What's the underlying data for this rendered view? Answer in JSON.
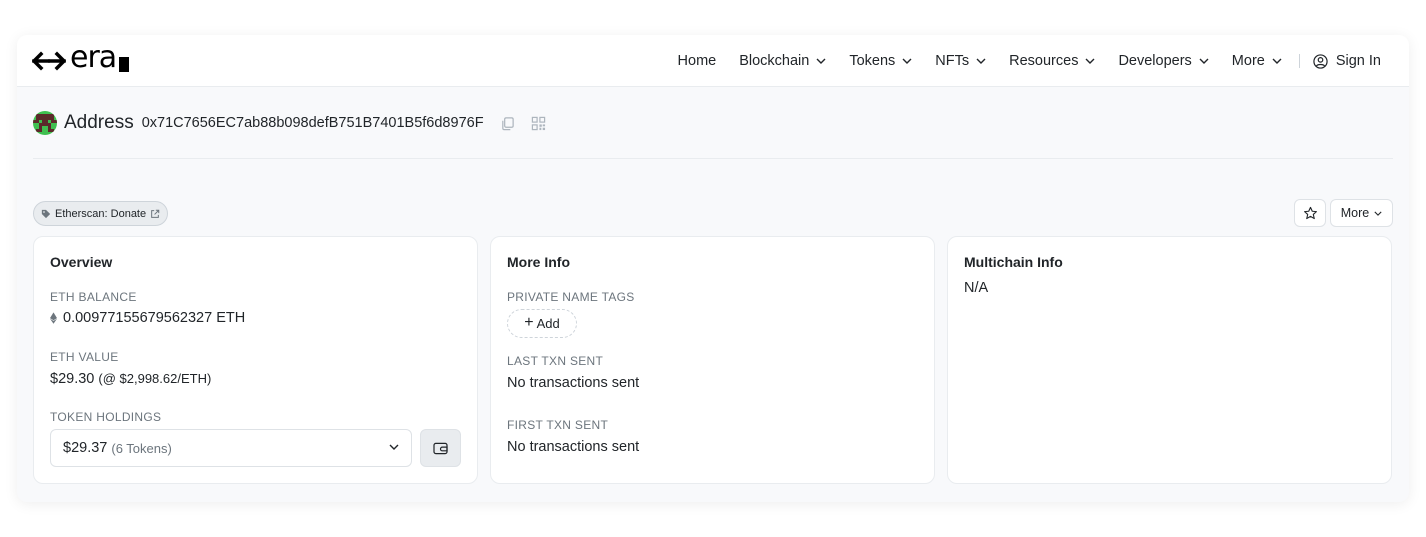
{
  "brand": {
    "logo_text": "era"
  },
  "nav": {
    "items": [
      {
        "label": "Home",
        "has_dropdown": false
      },
      {
        "label": "Blockchain",
        "has_dropdown": true
      },
      {
        "label": "Tokens",
        "has_dropdown": true
      },
      {
        "label": "NFTs",
        "has_dropdown": true
      },
      {
        "label": "Resources",
        "has_dropdown": true
      },
      {
        "label": "Developers",
        "has_dropdown": true
      },
      {
        "label": "More",
        "has_dropdown": true
      }
    ],
    "sign_in": "Sign In"
  },
  "address": {
    "title": "Address",
    "hash": "0x71C7656EC7ab88b098defB751B7401B5f6d8976F"
  },
  "tag": {
    "label": "Etherscan: Donate",
    "icon": "tag-icon"
  },
  "actions": {
    "more_label": "More"
  },
  "overview": {
    "title": "Overview",
    "eth_balance_label": "ETH BALANCE",
    "eth_balance_value": "0.00977155679562327 ETH",
    "eth_value_label": "ETH VALUE",
    "eth_value_amount": "$29.30",
    "eth_value_rate": "(@ $2,998.62/ETH)",
    "token_holdings_label": "TOKEN HOLDINGS",
    "token_holdings_value": "$29.37",
    "token_holdings_count": "(6 Tokens)"
  },
  "more_info": {
    "title": "More Info",
    "private_tags_label": "PRIVATE NAME TAGS",
    "add_label": "Add",
    "last_txn_label": "LAST TXN SENT",
    "last_txn_value": "No transactions sent",
    "first_txn_label": "FIRST TXN SENT",
    "first_txn_value": "No transactions sent"
  },
  "multichain": {
    "title": "Multichain Info",
    "value": "N/A"
  },
  "colors": {
    "accent": "#212529",
    "muted": "#6c757d",
    "border": "#e9ecef",
    "background": "#f8f9fb"
  }
}
